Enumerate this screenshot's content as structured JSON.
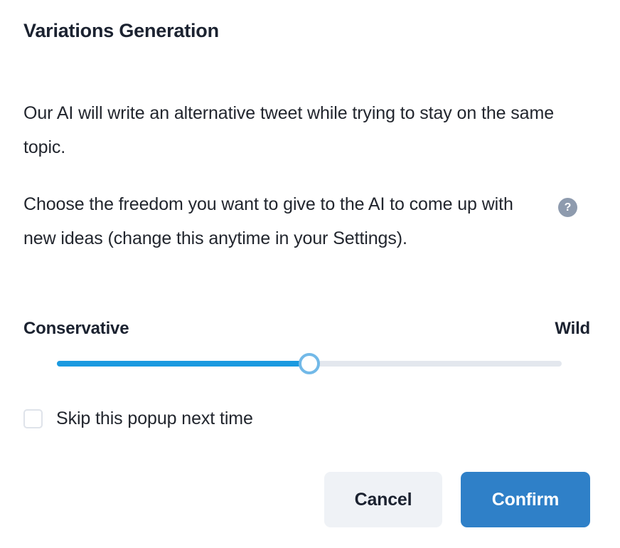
{
  "dialog": {
    "title": "Variations Generation",
    "paragraphs": [
      "Our AI will write an alternative tweet while trying to stay on the same topic.",
      "Choose the freedom you want to give to the AI to come up with new ideas (change this anytime in your Settings)."
    ],
    "help_icon": {
      "name": "help-icon",
      "glyph": "?",
      "color": "#8e9bae"
    },
    "slider": {
      "left_label": "Conservative",
      "right_label": "Wild",
      "value_percent": 50,
      "min": 0,
      "max": 100,
      "fill_color": "#1b9ae0",
      "track_color": "#e3e7ee",
      "thumb_ring_color": "#72b9e8"
    },
    "checkbox": {
      "label": "Skip this popup next time",
      "checked": false
    },
    "buttons": {
      "cancel_label": "Cancel",
      "confirm_label": "Confirm",
      "cancel_bg": "#eff2f6",
      "confirm_bg": "#2f80c8"
    }
  }
}
